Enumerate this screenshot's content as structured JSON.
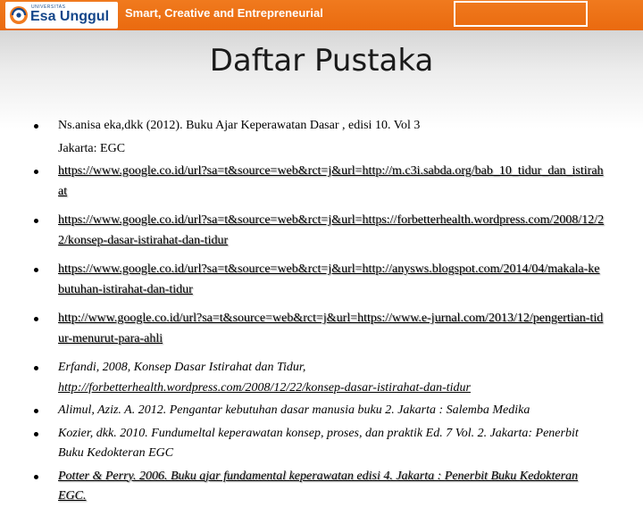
{
  "header": {
    "logo_small": "UNIVERSITAS",
    "logo_text": "Esa Unggul",
    "tagline": "Smart, Creative and Entrepreneurial"
  },
  "title": "Daftar Pustaka",
  "references": [
    {
      "line1": "Ns.anisa eka,dkk (2012). Buku Ajar Keperawatan Dasar , edisi 10. Vol 3",
      "line2": "Jakarta: EGC"
    },
    {
      "text": "https://www.google.co.id/url?sa=t&source=web&rct=j&url=http://m.c3i.sabda.org/bab_10_tidur_dan_istirahat"
    },
    {
      "text": "https://www.google.co.id/url?sa=t&source=web&rct=j&url=https://forbetterhealth.wordpress.com/2008/12/22/konsep-dasar-istirahat-dan-tidur"
    },
    {
      "text": "https://www.google.co.id/url?sa=t&source=web&rct=j&url=http://anysws.blogspot.com/2014/04/makala-kebutuhan-istirahat-dan-tidur"
    },
    {
      "text": "http://www.google.co.id/url?sa=t&source=web&rct=j&url=https://www.e-jurnal.com/2013/12/pengertian-tidur-menurut-para-ahli"
    },
    {
      "line1": "Erfandi, 2008, Konsep Dasar Istirahat dan Tidur,",
      "line2": "http://forbetterhealth.wordpress.com/2008/12/22/konsep-dasar-istirahat-dan-tidur"
    },
    {
      "text": "Alimul, Aziz. A. 2012. Pengantar kebutuhan dasar manusia buku 2. Jakarta : Salemba Medika"
    },
    {
      "text": "Kozier, dkk. 2010. Fundumeltal keperawatan konsep, proses, dan praktik Ed. 7 Vol. 2. Jakarta: Penerbit Buku Kedokteran EGC"
    },
    {
      "text": "Potter & Perry. 2006. Buku ajar fundamental keperawatan edisi 4. Jakarta : Penerbit Buku Kedokteran EGC."
    }
  ]
}
